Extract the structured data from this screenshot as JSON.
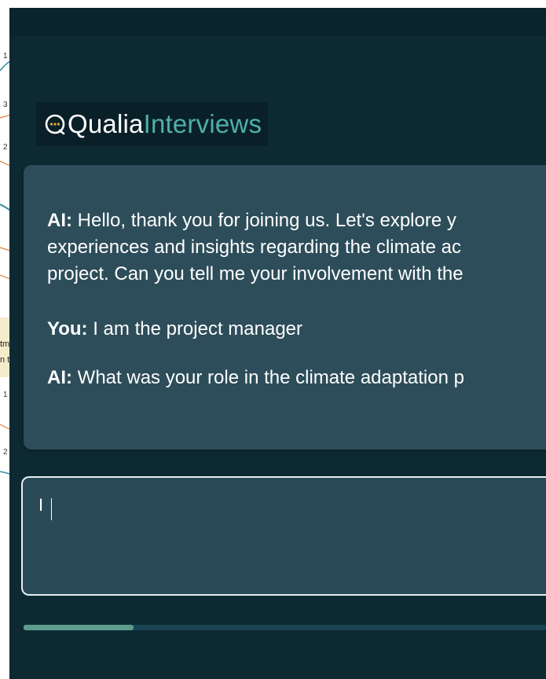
{
  "background_window": {
    "numbers": [
      "1",
      "3",
      "2",
      "1",
      "2"
    ],
    "note_lines": [
      "tm",
      "n t"
    ]
  },
  "app": {
    "logo_primary": "Qualia",
    "logo_secondary": "Interviews",
    "accent_color": "#4fb0a8"
  },
  "chat": {
    "messages": [
      {
        "speaker": "AI:",
        "lines": [
          "Hello, thank you for joining us. Let's explore y",
          "experiences and insights regarding the climate ac",
          "project. Can you tell me your involvement with the"
        ]
      },
      {
        "speaker": "You:",
        "lines": [
          "I am the project manager"
        ]
      },
      {
        "speaker": "AI:",
        "lines": [
          "What was your role in the climate adaptation p"
        ]
      }
    ]
  },
  "input": {
    "value": "I",
    "placeholder": ""
  },
  "progress": {
    "fraction": 0.21,
    "fill_color": "#5e9d8e"
  }
}
